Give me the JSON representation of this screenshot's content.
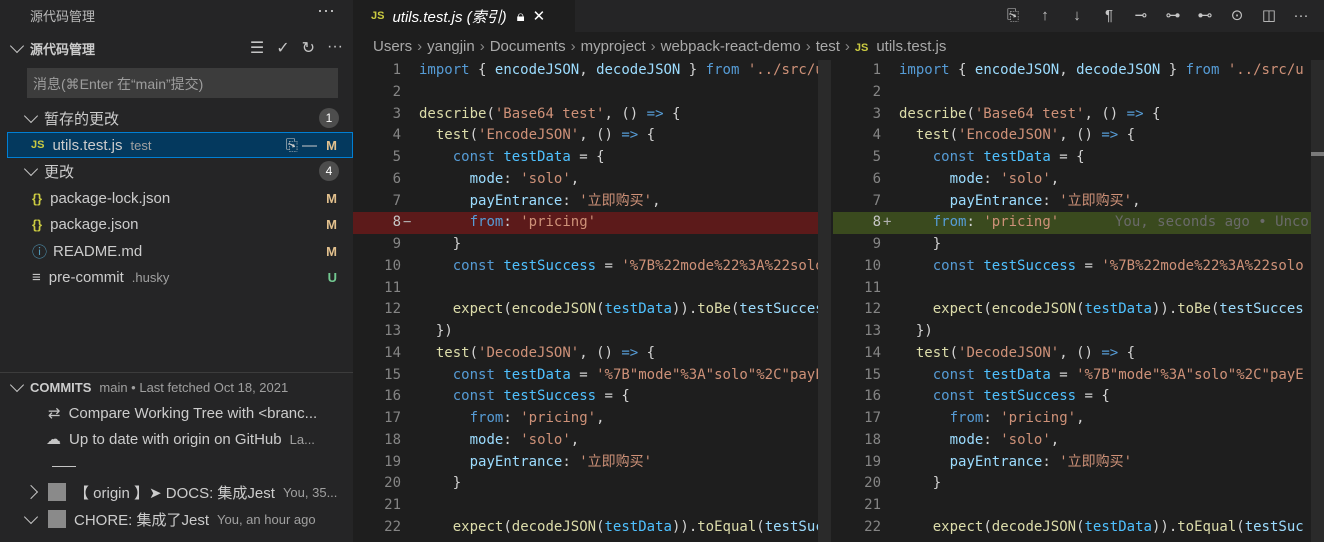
{
  "sidebar": {
    "title": "源代码管理",
    "section_label": "源代码管理",
    "commit_placeholder": "消息(⌘Enter 在“main”提交)",
    "staged": {
      "label": "暂存的更改",
      "count": "1",
      "items": [
        {
          "name": "utils.test.js",
          "desc": "test",
          "status": "M"
        }
      ]
    },
    "changes": {
      "label": "更改",
      "count": "4",
      "items": [
        {
          "icon": "{}",
          "name": "package-lock.json",
          "desc": "",
          "status": "M"
        },
        {
          "icon": "{}",
          "name": "package.json",
          "desc": "",
          "status": "M"
        },
        {
          "icon": "ⓘ",
          "name": "README.md",
          "desc": "",
          "status": "M"
        },
        {
          "icon": "≡",
          "name": "pre-commit",
          "desc": ".husky",
          "status": "U"
        }
      ]
    },
    "commits": {
      "label": "COMMITS",
      "meta": "main • Last fetched Oct 18, 2021",
      "rows": [
        {
          "text": "Compare Working Tree with <branc...",
          "meta": ""
        },
        {
          "text": "Up to date with origin on GitHub",
          "meta": "La..."
        },
        {
          "text": "【 origin 】➤  DOCS: 集成Jest",
          "meta": "You, 35..."
        },
        {
          "text": "CHORE: 集成了Jest",
          "meta": "You, an hour ago"
        }
      ]
    }
  },
  "editor": {
    "tab_label": "utils.test.js (索引)",
    "breadcrumb": [
      "Users",
      "yangjin",
      "Documents",
      "myproject",
      "webpack-react-demo",
      "test",
      "utils.test.js"
    ],
    "blame": "You, seconds ago • Unco"
  },
  "diff": {
    "left": [
      {
        "n": "1",
        "t": "import { encodeJSON, decodeJSON } from '../src/u"
      },
      {
        "n": "2",
        "t": ""
      },
      {
        "n": "3",
        "t": "describe('Base64 test', () => {"
      },
      {
        "n": "4",
        "t": "  test('EncodeJSON', () => {"
      },
      {
        "n": "5",
        "t": "    const testData = {"
      },
      {
        "n": "6",
        "t": "      mode: 'solo',"
      },
      {
        "n": "7",
        "t": "      payEntrance: '立即购买',"
      },
      {
        "n": "8",
        "t": "      from: 'pricing'",
        "mark": "−"
      },
      {
        "n": "9",
        "t": "    }"
      },
      {
        "n": "10",
        "t": "    const testSuccess = '%7B%22mode%22%3A%22solo"
      },
      {
        "n": "11",
        "t": ""
      },
      {
        "n": "12",
        "t": "    expect(encodeJSON(testData)).toBe(testSucces"
      },
      {
        "n": "13",
        "t": "  })"
      },
      {
        "n": "14",
        "t": "  test('DecodeJSON', () => {"
      },
      {
        "n": "15",
        "t": "    const testData = '%7B\"mode\"%3A\"solo\"%2C\"payE"
      },
      {
        "n": "16",
        "t": "    const testSuccess = {"
      },
      {
        "n": "17",
        "t": "      from: 'pricing',"
      },
      {
        "n": "18",
        "t": "      mode: 'solo',"
      },
      {
        "n": "19",
        "t": "      payEntrance: '立即购买'"
      },
      {
        "n": "20",
        "t": "    }"
      },
      {
        "n": "21",
        "t": ""
      },
      {
        "n": "22",
        "t": "    expect(decodeJSON(testData)).toEqual(testSuc"
      }
    ],
    "right": [
      {
        "n": "1",
        "t": "import { encodeJSON, decodeJSON } from '../src/u"
      },
      {
        "n": "2",
        "t": ""
      },
      {
        "n": "3",
        "t": "describe('Base64 test', () => {"
      },
      {
        "n": "4",
        "t": "  test('EncodeJSON', () => {"
      },
      {
        "n": "5",
        "t": "    const testData = {"
      },
      {
        "n": "6",
        "t": "      mode: 'solo',"
      },
      {
        "n": "7",
        "t": "      payEntrance: '立即购买',"
      },
      {
        "n": "8",
        "t": "    from: 'pricing'",
        "mark": "+"
      },
      {
        "n": "9",
        "t": "    }"
      },
      {
        "n": "10",
        "t": "    const testSuccess = '%7B%22mode%22%3A%22solo"
      },
      {
        "n": "11",
        "t": ""
      },
      {
        "n": "12",
        "t": "    expect(encodeJSON(testData)).toBe(testSucces"
      },
      {
        "n": "13",
        "t": "  })"
      },
      {
        "n": "14",
        "t": "  test('DecodeJSON', () => {"
      },
      {
        "n": "15",
        "t": "    const testData = '%7B\"mode\"%3A\"solo\"%2C\"payE"
      },
      {
        "n": "16",
        "t": "    const testSuccess = {"
      },
      {
        "n": "17",
        "t": "      from: 'pricing',"
      },
      {
        "n": "18",
        "t": "      mode: 'solo',"
      },
      {
        "n": "19",
        "t": "      payEntrance: '立即购买'"
      },
      {
        "n": "20",
        "t": "    }"
      },
      {
        "n": "21",
        "t": ""
      },
      {
        "n": "22",
        "t": "    expect(decodeJSON(testData)).toEqual(testSuc"
      }
    ]
  },
  "colors": {
    "removed": "#5c1a1a",
    "added": "#3a4a1e",
    "accent": "#007fd4"
  }
}
